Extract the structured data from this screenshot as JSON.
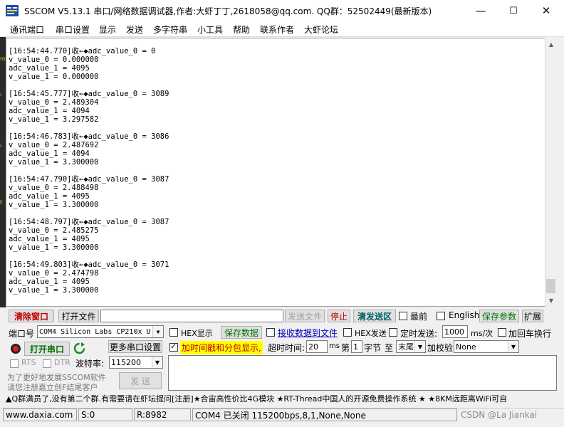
{
  "window": {
    "title": "SSCOM V5.13.1 串口/网络数据调试器,作者:大虾丁丁,2618058@qq.com. QQ群：52502449(最新版本)",
    "minimize": "—",
    "maximize": "☐",
    "close": "✕"
  },
  "menu": [
    "通讯端口",
    "串口设置",
    "显示",
    "发送",
    "多字符串",
    "小工具",
    "帮助",
    "联系作者",
    "大虾论坛"
  ],
  "receive_log": [
    "[16:54:44.770]收←◆adc_value_0 = 0",
    "v_value_0 = 0.000000",
    "adc_value_1 = 4095",
    "v_value_1 = 0.000000",
    "",
    "[16:54:45.777]收←◆adc_value_0 = 3089",
    "v_value_0 = 2.489304",
    "adc_value_1 = 4094",
    "v_value_1 = 3.297582",
    "",
    "[16:54:46.783]收←◆adc_value_0 = 3086",
    "v_value_0 = 2.487692",
    "adc_value_1 = 4094",
    "v_value_1 = 3.300000",
    "",
    "[16:54:47.790]收←◆adc_value_0 = 3087",
    "v_value_0 = 2.488498",
    "adc_value_1 = 4095",
    "v_value_1 = 3.300000",
    "",
    "[16:54:48.797]收←◆adc_value_0 = 3087",
    "v_value_0 = 2.485275",
    "adc_value_1 = 4095",
    "v_value_1 = 3.300000",
    "",
    "[16:54:49.803]收←◆adc_value_0 = 3071",
    "v_value_0 = 2.474798",
    "adc_value_1 = 4095",
    "v_value_1 = 3.300000"
  ],
  "toolbar": {
    "clear_window": "清除窗口",
    "open_file": "打开文件",
    "file_path": "",
    "send_file": "发送文件",
    "stop": "停止",
    "clear_send": "清发送区",
    "topmost": "最前",
    "english": "English",
    "save_params": "保存参数",
    "expand": "扩展"
  },
  "port": {
    "label": "端口号",
    "value": "COM4 Silicon Labs CP210x U",
    "more_settings": "更多串口设置",
    "open_button": "打开串口",
    "rts": "RTS",
    "dtr": "DTR",
    "baud_label": "波特率:",
    "baud_value": "115200"
  },
  "options": {
    "hex_display": "HEX显示",
    "save_data": "保存数据",
    "recv_to_file": "接收数据到文件",
    "hex_send": "HEX发送",
    "timed_send": "定时发送:",
    "interval_value": "1000",
    "interval_unit": "ms/次",
    "add_crlf": "加回车换行",
    "timestamp": "加时间戳和分包显示,",
    "timeout_label": "超时时间:",
    "timeout_value": "20",
    "timeout_unit": "ms",
    "byte_prefix": "第",
    "byte_value": "1",
    "byte_suffix": "字节",
    "to_label": "至",
    "end_value": "末尾",
    "checksum_label": "加校验",
    "checksum_value": "None"
  },
  "promo": {
    "line1": "为了更好地发展SSCOM软件",
    "line2": "请您注册嘉立创F结尾客户"
  },
  "send_button": "发  送",
  "banner": "▲Q群满员了,没有第二个群.有需要请在虾坛提问[注册]★合宙高性价比4G模块 ★RT-Thread中国人的开源免费操作系统 ★ ★8KM远距离WiFi可自",
  "status": {
    "url": "www.daxia.com",
    "sent": "S:0",
    "received": "R:8982",
    "port_state": "COM4 已关闭  115200bps,8,1,None,None",
    "watermark": "CSDN @La Jiankai"
  }
}
